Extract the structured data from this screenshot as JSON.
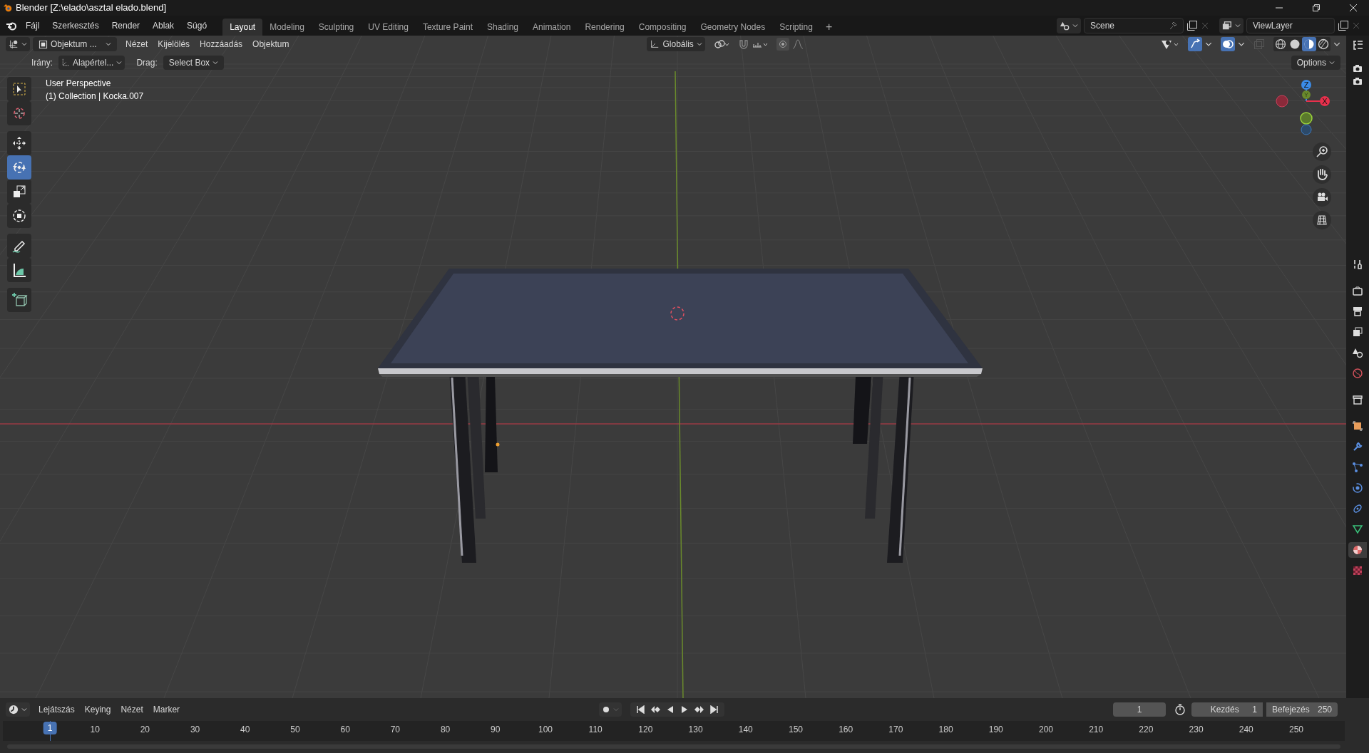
{
  "window": {
    "title": "Blender [Z:\\elado\\asztal elado.blend]"
  },
  "menus": [
    "Fájl",
    "Szerkesztés",
    "Render",
    "Ablak",
    "Súgó"
  ],
  "workspaces": [
    {
      "label": "Layout",
      "selected": true
    },
    {
      "label": "Modeling",
      "selected": false
    },
    {
      "label": "Sculpting",
      "selected": false
    },
    {
      "label": "UV Editing",
      "selected": false
    },
    {
      "label": "Texture Paint",
      "selected": false
    },
    {
      "label": "Shading",
      "selected": false
    },
    {
      "label": "Animation",
      "selected": false
    },
    {
      "label": "Rendering",
      "selected": false
    },
    {
      "label": "Compositing",
      "selected": false
    },
    {
      "label": "Geometry Nodes",
      "selected": false
    },
    {
      "label": "Scripting",
      "selected": false
    }
  ],
  "add_workspace": "+",
  "scene": "Scene",
  "view_layer": "ViewLayer",
  "viewport_header": {
    "mode": "Objektum ...",
    "menus": [
      "Nézet",
      "Kijelölés",
      "Hozzáadás",
      "Objektum"
    ],
    "orientation": "Globális",
    "shading": [
      {
        "kind": "wireframe",
        "selected": false
      },
      {
        "kind": "solid",
        "selected": false
      },
      {
        "kind": "material",
        "selected": true
      },
      {
        "kind": "rendered",
        "selected": false
      }
    ]
  },
  "tool_settings": {
    "direction_label": "Irány:",
    "direction_value": "Alapértel...",
    "drag_label": "Drag:",
    "drag_value": "Select Box",
    "options": "Options"
  },
  "overlay": {
    "view": "User Perspective",
    "object": "(1) Collection | Kocka.007"
  },
  "tools": [
    {
      "kind": "select",
      "selected": false
    },
    {
      "kind": "cursor",
      "selected": false
    },
    {
      "kind": "move",
      "selected": false
    },
    {
      "kind": "rotate",
      "selected": true
    },
    {
      "kind": "scale",
      "selected": false
    },
    {
      "kind": "transform",
      "selected": false
    },
    {
      "kind": "annotate",
      "selected": false
    },
    {
      "kind": "measure",
      "selected": false
    },
    {
      "kind": "add",
      "selected": false
    }
  ],
  "gizmo": {
    "z": "Z",
    "y": "Y",
    "x": "X"
  },
  "property_tabs": [
    {
      "kind": "tool",
      "selected": false
    },
    {
      "kind": "render",
      "selected": false
    },
    {
      "kind": "output",
      "selected": false
    },
    {
      "kind": "view_layer",
      "selected": false
    },
    {
      "kind": "scene",
      "selected": false
    },
    {
      "kind": "world",
      "selected": false
    },
    {
      "kind": "collection",
      "selected": false
    },
    {
      "kind": "object",
      "selected": false
    },
    {
      "kind": "modifier",
      "selected": false
    },
    {
      "kind": "particles",
      "selected": false
    },
    {
      "kind": "physics",
      "selected": false
    },
    {
      "kind": "constraints",
      "selected": false
    },
    {
      "kind": "data",
      "selected": false
    },
    {
      "kind": "material",
      "selected": true
    },
    {
      "kind": "texture",
      "selected": false
    }
  ],
  "timeline": {
    "menus": [
      "Lejátszás",
      "Keying",
      "Nézet",
      "Marker"
    ],
    "current_frame": "1",
    "start_label": "Kezdés",
    "start_value": "1",
    "end_label": "Befejezés",
    "end_value": "250",
    "ruler": [
      "10",
      "20",
      "30",
      "40",
      "50",
      "60",
      "70",
      "80",
      "90",
      "100",
      "110",
      "120",
      "130",
      "140",
      "150",
      "160",
      "170",
      "180",
      "190",
      "200",
      "210",
      "220",
      "230",
      "240",
      "250"
    ],
    "ruler_current": "1"
  }
}
